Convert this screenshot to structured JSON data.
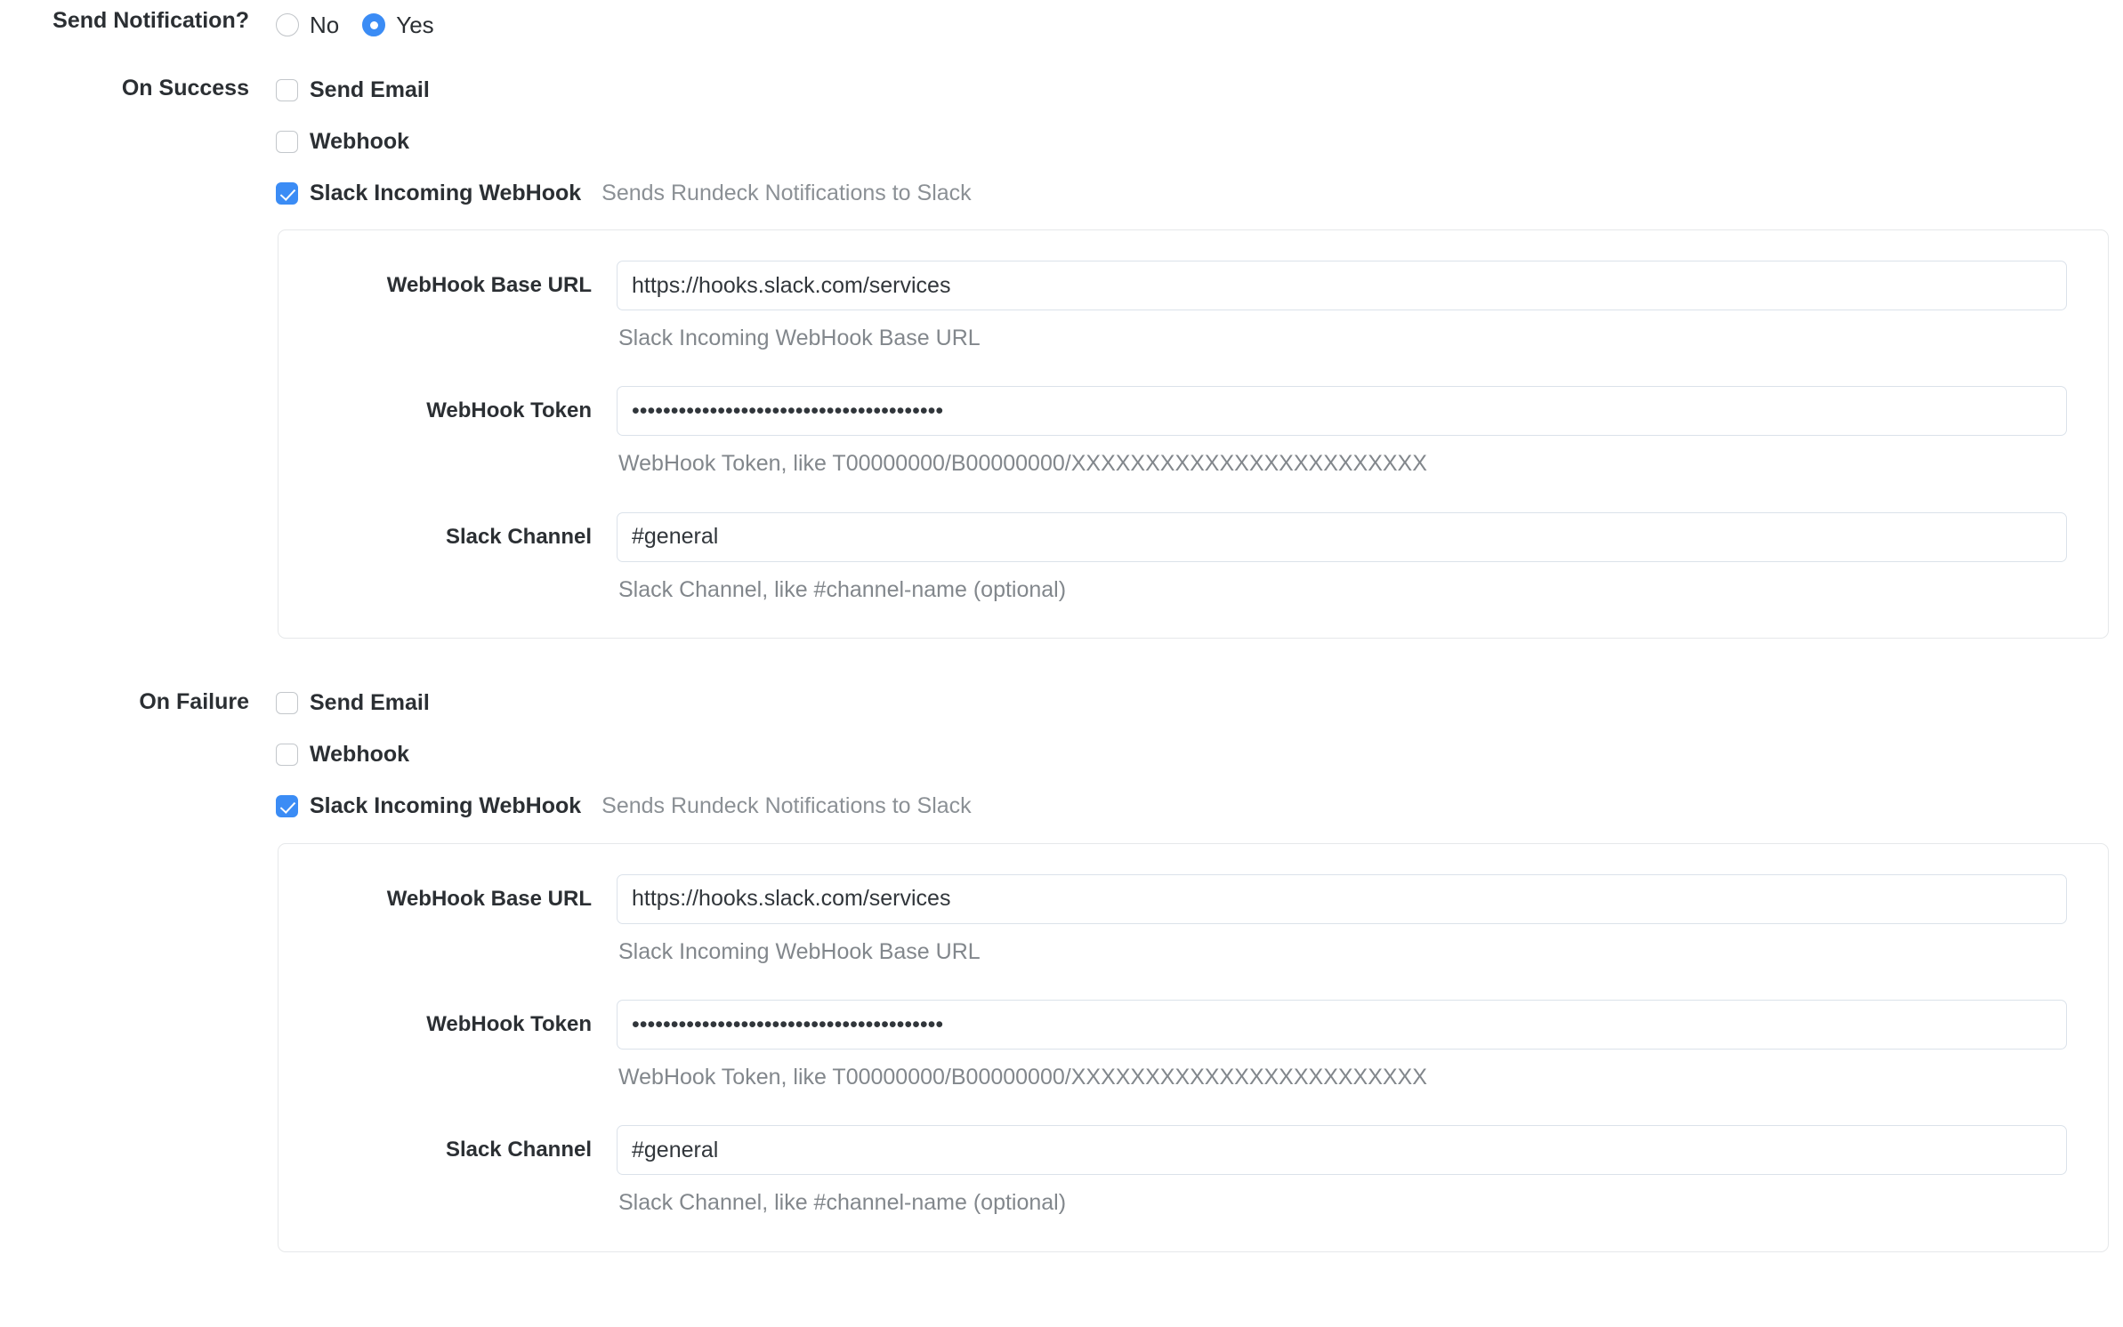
{
  "send_notification": {
    "label": "Send Notification?",
    "options": [
      {
        "value": "no",
        "label": "No",
        "selected": false
      },
      {
        "value": "yes",
        "label": "Yes",
        "selected": true
      }
    ]
  },
  "plugin_fields": {
    "base_url": {
      "label": "WebHook Base URL",
      "value": "https://hooks.slack.com/services",
      "placeholder": "",
      "help": "Slack Incoming WebHook Base URL"
    },
    "token": {
      "label": "WebHook Token",
      "value": "••••••••••••••••••••••••••••••••••••••••",
      "placeholder": "",
      "help": "WebHook Token, like T00000000/B00000000/XXXXXXXXXXXXXXXXXXXXXXXX"
    },
    "channel": {
      "label": "Slack Channel",
      "value": "#general",
      "placeholder": "",
      "help": "Slack Channel, like #channel-name (optional)"
    }
  },
  "on_success": {
    "label": "On Success",
    "send_email": {
      "label": "Send Email",
      "checked": false
    },
    "webhook": {
      "label": "Webhook",
      "checked": false
    },
    "slack": {
      "label": "Slack Incoming WebHook",
      "description": "Sends Rundeck Notifications to Slack",
      "checked": true
    }
  },
  "on_failure": {
    "label": "On Failure",
    "send_email": {
      "label": "Send Email",
      "checked": false
    },
    "webhook": {
      "label": "Webhook",
      "checked": false
    },
    "slack": {
      "label": "Slack Incoming WebHook",
      "description": "Sends Rundeck Notifications to Slack",
      "checked": true
    }
  },
  "colors": {
    "accent": "#3b8cf5",
    "text": "#2b2f33",
    "muted": "#82878c",
    "input_border": "#dbe2ea",
    "panel_border": "#e6e8ea"
  }
}
